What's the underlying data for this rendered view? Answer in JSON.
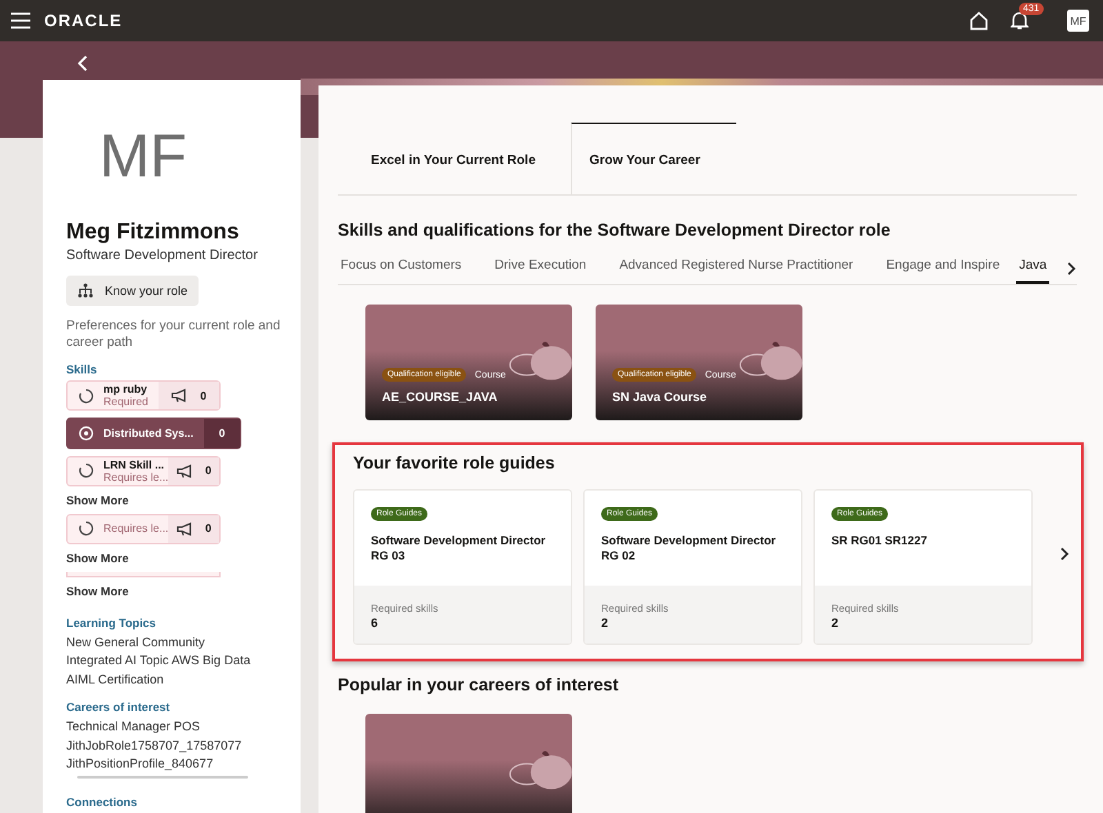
{
  "topbar": {
    "logo": "ORACLE",
    "notifications": "431",
    "avatar": "MF"
  },
  "profile": {
    "initials": "MF",
    "name": "Meg Fitzimmons",
    "title": "Software Development Director",
    "know_role": "Know your role",
    "preferences": "Preferences for your current role and career path"
  },
  "skills": {
    "label": "Skills",
    "items": [
      {
        "name": "mp ruby",
        "note": "Required",
        "count": "0",
        "selected": false
      },
      {
        "name": "Distributed Sys...",
        "count": "0",
        "selected": true
      },
      {
        "name": "LRN Skill ...",
        "note": "Requires le...",
        "count": "0",
        "selected": false
      },
      {
        "note": "Requires le...",
        "count": "0",
        "selected": false
      }
    ],
    "show_more": [
      "Show More",
      "Show More",
      "Show More"
    ]
  },
  "learning_topics": {
    "label": "Learning Topics",
    "items": [
      "New General Community",
      "Integrated AI Topic AWS Big Data",
      "AIML Certification"
    ]
  },
  "careers": {
    "label": "Careers of interest",
    "items": [
      "Technical Manager POS",
      "JithJobRole1758707_17587077",
      "JithPositionProfile_840677"
    ]
  },
  "connections": {
    "label": "Connections"
  },
  "tabs": [
    {
      "label": "Excel in Your Current Role",
      "selected": false
    },
    {
      "label": "Grow Your Career",
      "selected": true
    }
  ],
  "skills_heading": "Skills and qualifications for the Software Development Director role",
  "skill_tabs": [
    {
      "label": "Focus on Customers",
      "selected": false
    },
    {
      "label": "Drive Execution",
      "selected": false
    },
    {
      "label": "Advanced Registered Nurse Practitioner",
      "selected": false
    },
    {
      "label": "Engage and Inspire",
      "selected": false
    },
    {
      "label": "Java",
      "selected": true
    }
  ],
  "courses": [
    {
      "badge": "Qualification eligible",
      "type": "Course",
      "title": "AE_COURSE_JAVA"
    },
    {
      "badge": "Qualification eligible",
      "type": "Course",
      "title": "SN Java Course"
    }
  ],
  "favorites": {
    "heading": "Your favorite role guides",
    "guides": [
      {
        "badge": "Role Guides",
        "title": "Software Development Director RG 03",
        "label": "Required skills",
        "count": "6"
      },
      {
        "badge": "Role Guides",
        "title": "Software Development Director RG 02",
        "label": "Required skills",
        "count": "2"
      },
      {
        "badge": "Role Guides",
        "title": "SR RG01 SR1227",
        "label": "Required skills",
        "count": "2"
      }
    ]
  },
  "popular": {
    "heading": "Popular in your careers of interest"
  }
}
